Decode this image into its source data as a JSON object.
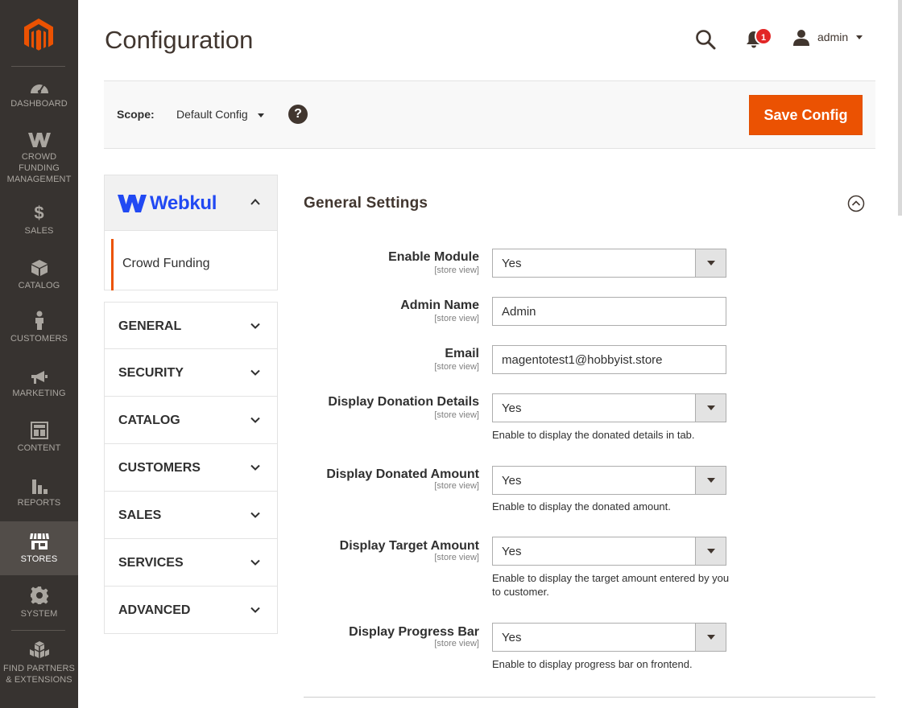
{
  "nav": {
    "items": [
      {
        "key": "dashboard",
        "label": "DASHBOARD",
        "icon": "gauge-icon"
      },
      {
        "key": "crowd",
        "label": "CROWD FUNDING MANAGEMENT",
        "icon": "webkul-w-icon"
      },
      {
        "key": "sales",
        "label": "SALES",
        "icon": "dollar-icon"
      },
      {
        "key": "catalog",
        "label": "CATALOG",
        "icon": "box-icon"
      },
      {
        "key": "customers",
        "label": "CUSTOMERS",
        "icon": "person-icon"
      },
      {
        "key": "marketing",
        "label": "MARKETING",
        "icon": "megaphone-icon"
      },
      {
        "key": "content",
        "label": "CONTENT",
        "icon": "layout-icon"
      },
      {
        "key": "reports",
        "label": "REPORTS",
        "icon": "bar-chart-icon"
      },
      {
        "key": "stores",
        "label": "STORES",
        "icon": "storefront-icon"
      },
      {
        "key": "system",
        "label": "SYSTEM",
        "icon": "gear-icon"
      },
      {
        "key": "partners",
        "label": "FIND PARTNERS & EXTENSIONS",
        "icon": "cubes-icon"
      }
    ],
    "active": "stores"
  },
  "header": {
    "title": "Configuration",
    "notifications_count": "1",
    "username": "admin"
  },
  "scope": {
    "label": "Scope:",
    "value": "Default Config",
    "help": "?",
    "save_label": "Save Config"
  },
  "tabs": {
    "vendor": "Webkul",
    "vendor_sub": "Crowd Funding",
    "groups": [
      "GENERAL",
      "SECURITY",
      "CATALOG",
      "CUSTOMERS",
      "SALES",
      "SERVICES",
      "ADVANCED"
    ]
  },
  "section": {
    "title": "General Settings",
    "fields": [
      {
        "label": "Enable Module",
        "scope": "[store view]",
        "type": "select",
        "value": "Yes",
        "note": ""
      },
      {
        "label": "Admin Name",
        "scope": "[store view]",
        "type": "text",
        "value": "Admin",
        "note": ""
      },
      {
        "label": "Email",
        "scope": "[store view]",
        "type": "text",
        "value": "magentotest1@hobbyist.store",
        "note": ""
      },
      {
        "label": "Display Donation Details",
        "scope": "[store view]",
        "type": "select",
        "value": "Yes",
        "note": "Enable to display the donated details in tab."
      },
      {
        "label": "Display Donated Amount",
        "scope": "[store view]",
        "type": "select",
        "value": "Yes",
        "note": "Enable to display the donated amount."
      },
      {
        "label": "Display Target Amount",
        "scope": "[store view]",
        "type": "select",
        "value": "Yes",
        "note": "Enable to display the target amount entered by you to customer."
      },
      {
        "label": "Display Progress Bar",
        "scope": "[store view]",
        "type": "select",
        "value": "Yes",
        "note": "Enable to display progress bar on frontend."
      }
    ]
  },
  "colors": {
    "nav_bg": "#373330",
    "nav_active": "#524d49",
    "accent": "#eb5202",
    "webkul_blue": "#2149f3",
    "badge": "#e22626"
  }
}
